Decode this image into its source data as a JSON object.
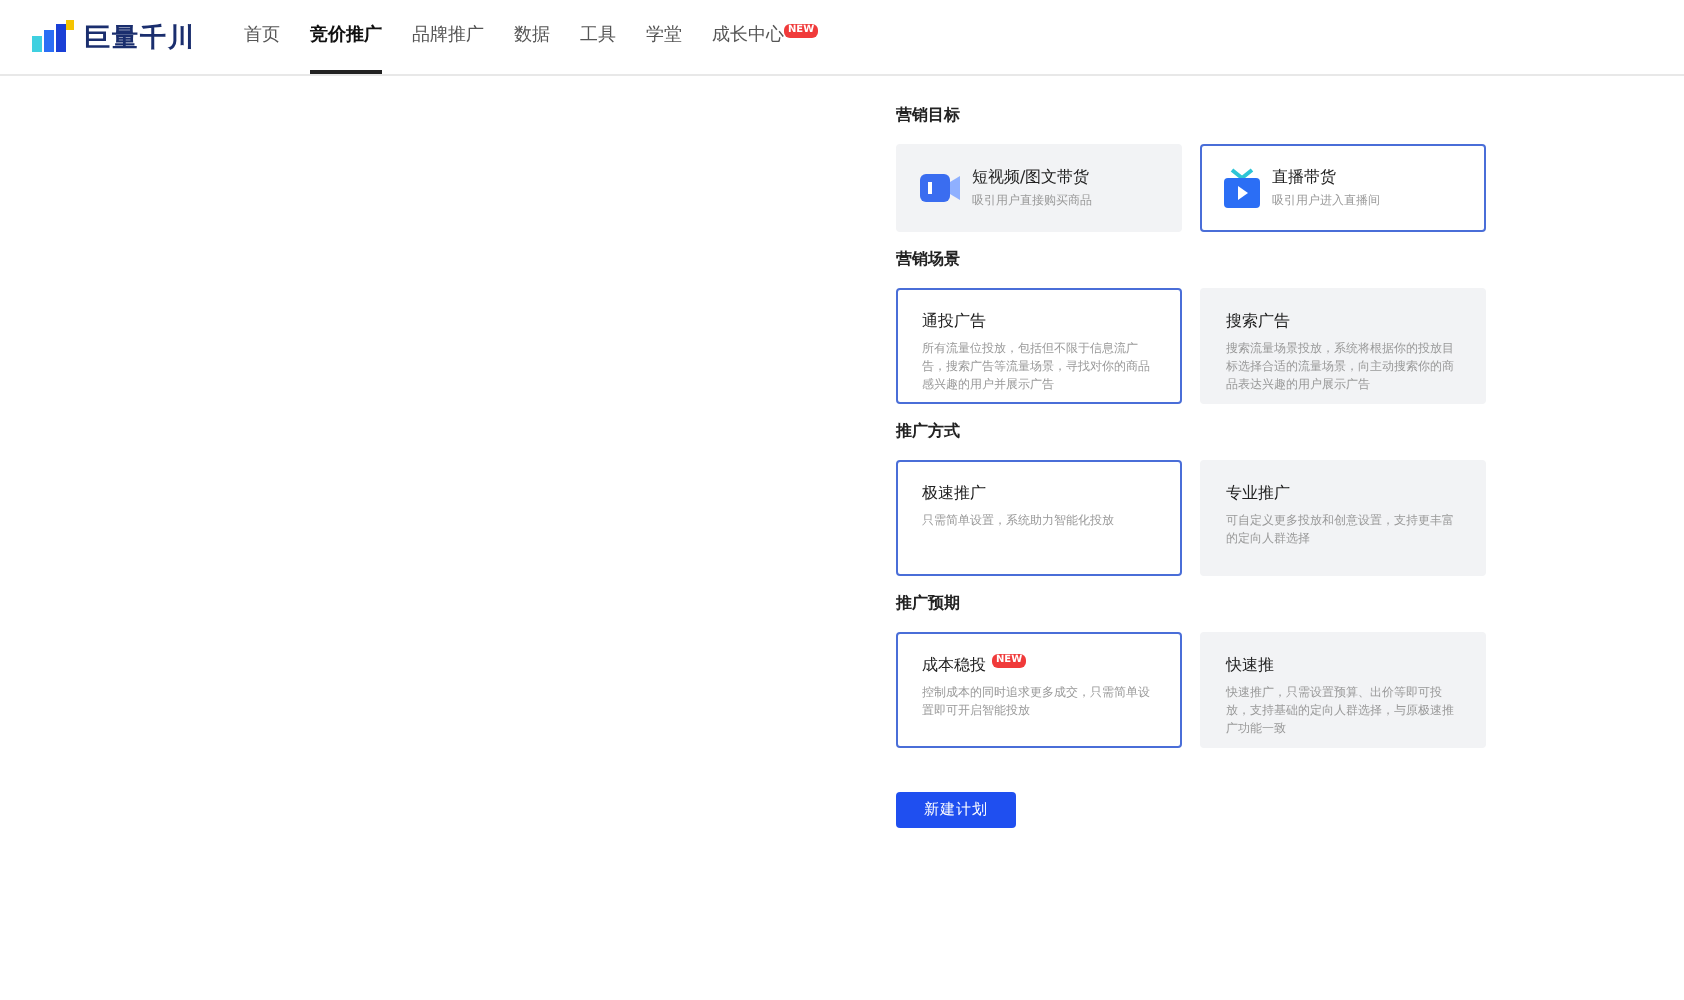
{
  "header": {
    "logo": "巨量千川",
    "nav": [
      {
        "label": "首页",
        "selected": false
      },
      {
        "label": "竞价推广",
        "selected": true
      },
      {
        "label": "品牌推广",
        "selected": false
      },
      {
        "label": "数据",
        "selected": false
      },
      {
        "label": "工具",
        "selected": false
      },
      {
        "label": "学堂",
        "selected": false
      },
      {
        "label": "成长中心",
        "selected": false,
        "badge": "NEW"
      }
    ]
  },
  "sections": [
    {
      "title": "营销目标",
      "options": [
        {
          "kind": "video",
          "title": "短视频/图文带货",
          "desc": "吸引用户直接购买商品",
          "selected": false
        },
        {
          "kind": "live",
          "title": "直播带货",
          "desc": "吸引用户进入直播间",
          "selected": true
        }
      ]
    },
    {
      "title": "营销场景",
      "options": [
        {
          "kind": "text",
          "title": "通投广告",
          "desc": "所有流量位投放，包括但不限于信息流广告，搜索广告等流量场景，寻找对你的商品感兴趣的用户并展示广告",
          "selected": true
        },
        {
          "kind": "text",
          "title": "搜索广告",
          "desc": "搜索流量场景投放，系统将根据你的投放目标选择合适的流量场景，向主动搜索你的商品表达兴趣的用户展示广告",
          "selected": false
        }
      ]
    },
    {
      "title": "推广方式",
      "options": [
        {
          "kind": "text",
          "title": "极速推广",
          "desc": "只需简单设置，系统助力智能化投放",
          "selected": true
        },
        {
          "kind": "text",
          "title": "专业推广",
          "desc": "可自定义更多投放和创意设置，支持更丰富的定向人群选择",
          "selected": false
        }
      ]
    },
    {
      "title": "推广预期",
      "options": [
        {
          "kind": "text",
          "title": "成本稳投",
          "badge": "NEW",
          "desc": "控制成本的同时追求更多成交，只需简单设置即可开启智能投放",
          "selected": true
        },
        {
          "kind": "text",
          "title": "快速推",
          "desc": "快速推广，只需设置预算、出价等即可投放，支持基础的定向人群选择，与原极速推广功能一致",
          "selected": false
        }
      ]
    }
  ],
  "button": "新建计划"
}
